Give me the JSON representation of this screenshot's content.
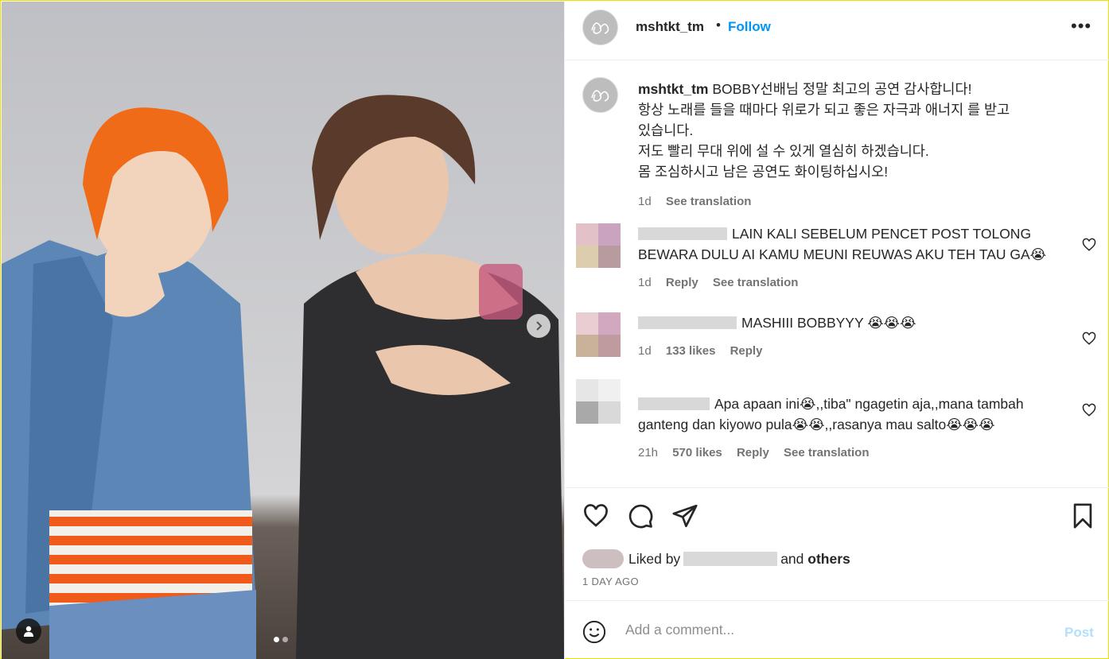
{
  "header": {
    "username": "mshtkt_tm",
    "separator": "•",
    "follow_label": "Follow",
    "more_label": "•••"
  },
  "caption": {
    "username": "mshtkt_tm",
    "lines": [
      "BOBBY선배님 정말 최고의 공연 감사합니다!",
      "항상 노래를 들을 때마다 위로가 되고 좋은 자극과 애너지 를 받고",
      "있습니다.",
      "저도 빨리 무대 위에 설 수 있게 열심히 하겠습니다.",
      "몸 조심하시고 남은 공연도 화이팅하십시오!"
    ],
    "time": "1d",
    "see_translation": "See translation"
  },
  "comments": [
    {
      "line1": "LAIN KALI SEBELUM PENCET POST TOLONG",
      "line2": "BEWARA DULU AI KAMU MEUNI REUWAS AKU TEH TAU GA😭",
      "time": "1d",
      "likes": "",
      "reply": "Reply",
      "see_translation": "See translation",
      "avatar_colors": [
        "#e2c1c8",
        "#c9a3bf",
        "#dccdae",
        "#b89b9f"
      ]
    },
    {
      "line1": "MASHIII BOBBYYY 😭😭😭",
      "line2": "",
      "time": "1d",
      "likes": "133 likes",
      "reply": "Reply",
      "see_translation": "",
      "avatar_colors": [
        "#e8cdd2",
        "#d1a8bd",
        "#c9b29a",
        "#bf9a9f"
      ]
    },
    {
      "line1": "Apa apaan ini😭,,tiba\" ngagetin aja,,mana tambah",
      "line2": "ganteng dan kiyowo pula😭😭,,rasanya mau salto😭😭😭",
      "time": "21h",
      "likes": "570 likes",
      "reply": "Reply",
      "see_translation": "See translation",
      "avatar_colors": [
        "#e6e6e6",
        "#f0f0f0",
        "#a9a9a9",
        "#d9d9d9"
      ]
    }
  ],
  "actions": {
    "like_icon": "heart-icon",
    "comment_icon": "comment-icon",
    "share_icon": "share-icon",
    "save_icon": "bookmark-icon"
  },
  "likes": {
    "prefix": "Liked by",
    "middle": "and",
    "others": "others",
    "time_ago": "1 DAY AGO"
  },
  "add_comment": {
    "placeholder": "Add a comment...",
    "post_label": "Post",
    "emoji_icon": "emoji-icon"
  },
  "colors": {
    "accent": "#0095f6",
    "post_disabled": "#b2dffc",
    "muted": "#737373"
  }
}
